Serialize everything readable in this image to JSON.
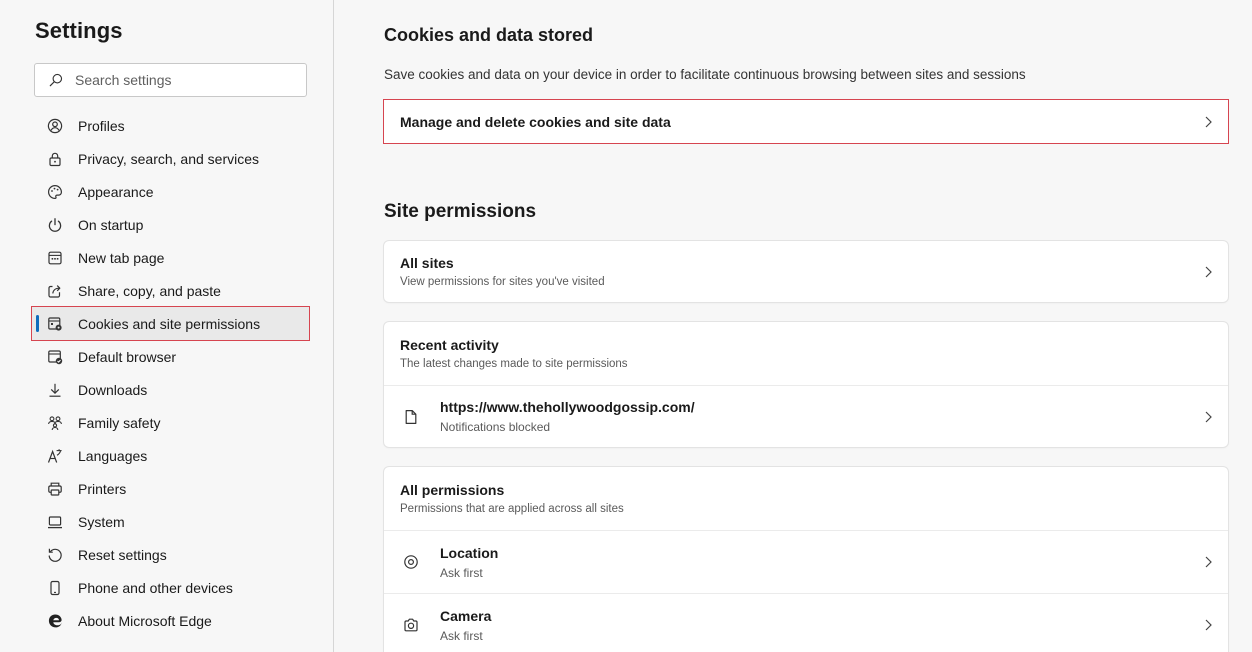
{
  "sidebar": {
    "title": "Settings",
    "search_placeholder": "Search settings",
    "items": [
      {
        "label": "Profiles",
        "icon": "profile-icon"
      },
      {
        "label": "Privacy, search, and services",
        "icon": "lock-icon"
      },
      {
        "label": "Appearance",
        "icon": "palette-icon"
      },
      {
        "label": "On startup",
        "icon": "power-icon"
      },
      {
        "label": "New tab page",
        "icon": "new-tab-icon"
      },
      {
        "label": "Share, copy, and paste",
        "icon": "share-icon"
      },
      {
        "label": "Cookies and site permissions",
        "icon": "cookie-settings-icon",
        "active": true
      },
      {
        "label": "Default browser",
        "icon": "browser-icon"
      },
      {
        "label": "Downloads",
        "icon": "download-icon"
      },
      {
        "label": "Family safety",
        "icon": "family-icon"
      },
      {
        "label": "Languages",
        "icon": "language-icon"
      },
      {
        "label": "Printers",
        "icon": "printer-icon"
      },
      {
        "label": "System",
        "icon": "system-icon"
      },
      {
        "label": "Reset settings",
        "icon": "reset-icon"
      },
      {
        "label": "Phone and other devices",
        "icon": "phone-icon"
      },
      {
        "label": "About Microsoft Edge",
        "icon": "edge-logo-icon"
      }
    ]
  },
  "main": {
    "cookies": {
      "title": "Cookies and data stored",
      "description": "Save cookies and data on your device in order to facilitate continuous browsing between sites and sessions",
      "manage_label": "Manage and delete cookies and site data"
    },
    "site_permissions": {
      "title": "Site permissions",
      "all_sites": {
        "title": "All sites",
        "subtitle": "View permissions for sites you've visited"
      },
      "recent_activity": {
        "title": "Recent activity",
        "subtitle": "The latest changes made to site permissions",
        "items": [
          {
            "url": "https://www.thehollywoodgossip.com/",
            "status": "Notifications blocked",
            "icon": "page-icon"
          }
        ]
      },
      "all_permissions": {
        "title": "All permissions",
        "subtitle": "Permissions that are applied across all sites",
        "items": [
          {
            "label": "Location",
            "value": "Ask first",
            "icon": "location-icon"
          },
          {
            "label": "Camera",
            "value": "Ask first",
            "icon": "camera-icon"
          }
        ]
      }
    }
  },
  "colors": {
    "accent": "#0f6cbd",
    "highlight_border": "#d64550",
    "background": "#f7f7f7",
    "card": "#ffffff"
  }
}
